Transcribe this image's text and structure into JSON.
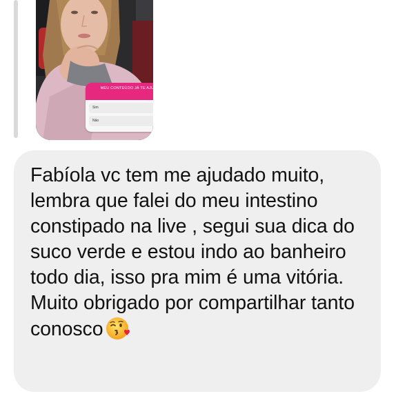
{
  "reply": {
    "story_poll": {
      "question": "MEU CONTEÚDO JÁ TE AJUDOU?",
      "options": [
        "Sim",
        "Não"
      ]
    }
  },
  "message": {
    "paragraph_1": "Fabíola vc tem me ajudado muito, lembra que falei do meu intestino constipado na live , segui sua dica do suco verde e estou indo ao banheiro todo dia, isso pra mim é uma vitória.",
    "paragraph_2": "Muito obrigado por compartilhar tanto conosco",
    "emoji_icon": "kissing-face-with-heart-emoji"
  },
  "colors": {
    "bubble_bg": "#efefef",
    "poll_accent": "#e6287f"
  }
}
